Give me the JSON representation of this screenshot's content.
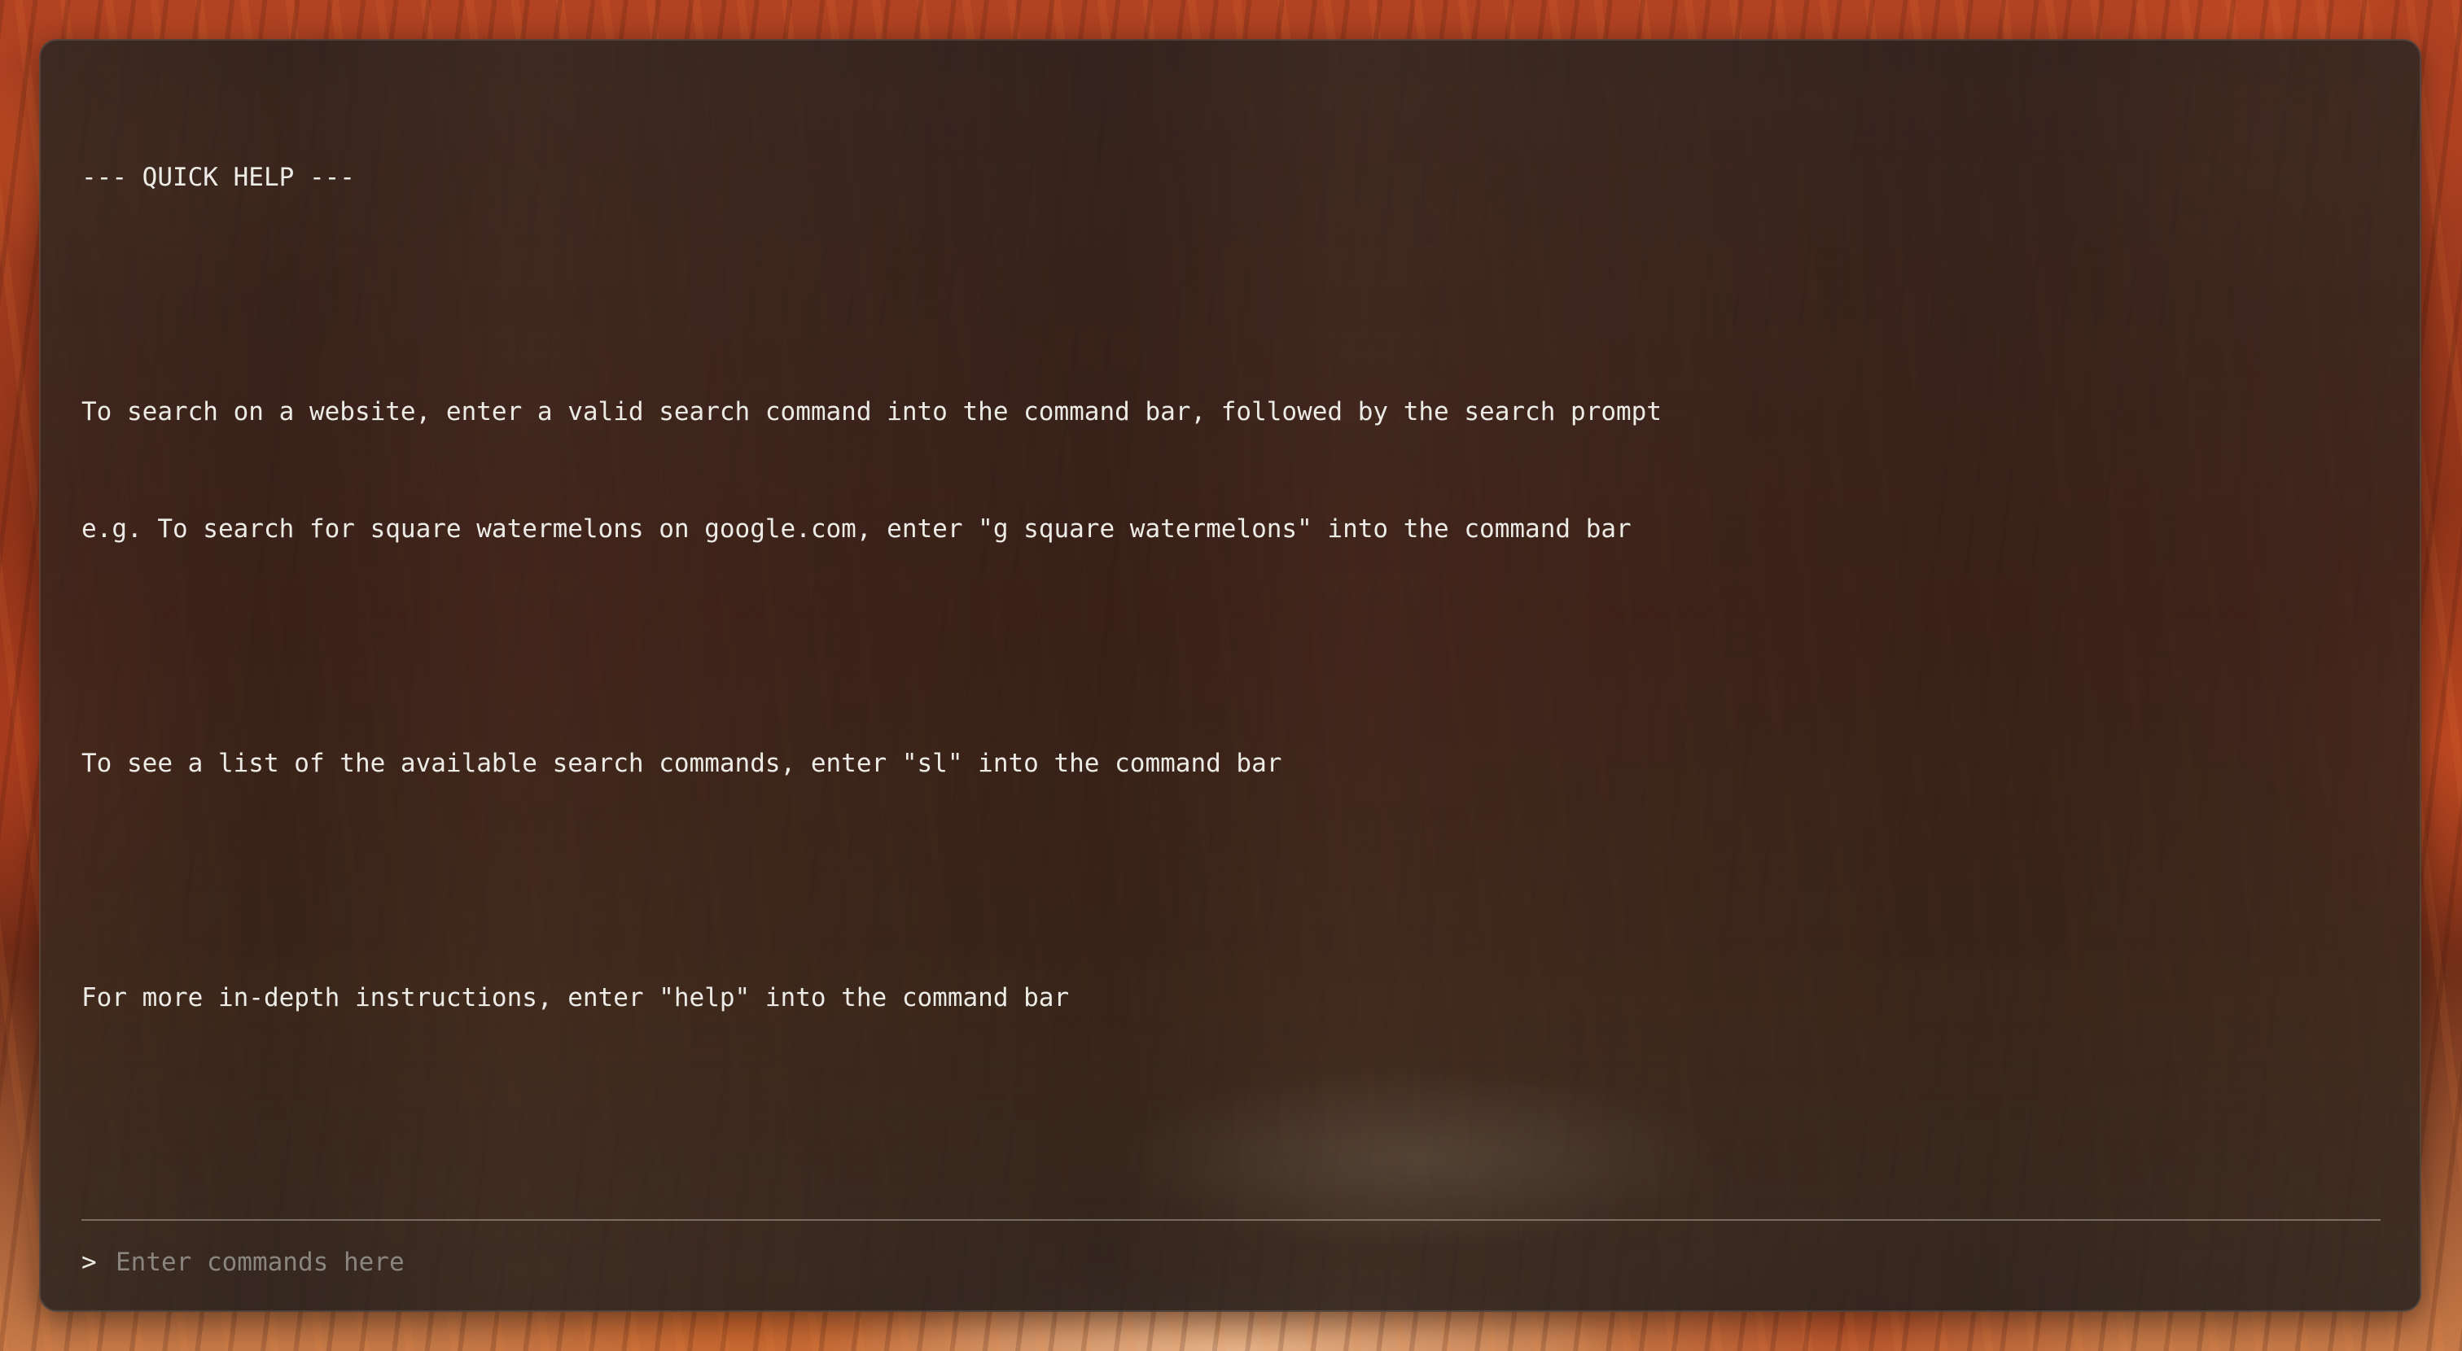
{
  "quick_help": {
    "heading": "--- QUICK HELP ---",
    "line_1": "To search on a website, enter a valid search command into the command bar, followed by the search prompt",
    "line_2": "e.g. To search for square watermelons on google.com, enter \"g square watermelons\" into the command bar",
    "line_3": "To see a list of the available search commands, enter \"sl\" into the command bar",
    "line_4": "For more in-depth instructions, enter \"help\" into the command bar"
  },
  "command_bar": {
    "prompt_symbol": ">",
    "value": "",
    "placeholder": "Enter commands here"
  }
}
